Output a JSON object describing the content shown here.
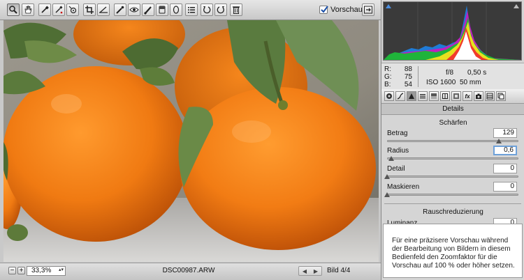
{
  "toolbar": {
    "tools": [
      {
        "name": "zoom-tool-button",
        "icon": "magnifier-icon",
        "active": true
      },
      {
        "name": "hand-tool-button",
        "icon": "hand-icon"
      },
      {
        "name": "white-balance-tool-button",
        "icon": "eyedropper-icon"
      },
      {
        "name": "color-sampler-tool-button",
        "icon": "color-sampler-icon"
      },
      {
        "name": "targeted-adjustment-tool-button",
        "icon": "target-adjust-icon"
      },
      {
        "name": "crop-tool-button",
        "icon": "crop-icon"
      },
      {
        "name": "straighten-tool-button",
        "icon": "straighten-icon"
      },
      {
        "name": "spot-removal-tool-button",
        "icon": "spot-removal-icon"
      },
      {
        "name": "red-eye-tool-button",
        "icon": "red-eye-icon"
      },
      {
        "name": "adjustment-brush-button",
        "icon": "brush-icon"
      },
      {
        "name": "graduated-filter-button",
        "icon": "graduated-filter-icon"
      },
      {
        "name": "radial-filter-button",
        "icon": "radial-filter-icon"
      },
      {
        "name": "preferences-button",
        "icon": "list-icon"
      },
      {
        "name": "rotate-left-button",
        "icon": "rotate-ccw-icon"
      },
      {
        "name": "rotate-right-button",
        "icon": "rotate-cw-icon"
      },
      {
        "name": "trash-button",
        "icon": "trash-icon"
      }
    ],
    "preview_label": "Vorschau",
    "preview_checked": true
  },
  "bottombar": {
    "zoom_minus": "−",
    "zoom_plus": "+",
    "zoom_value": "33,3%",
    "filename": "DSC00987.ARW",
    "image_count": "Bild 4/4"
  },
  "readout": {
    "r_label": "R:",
    "r_value": "88",
    "g_label": "G:",
    "g_value": "75",
    "b_label": "B:",
    "b_value": "54",
    "aperture": "f/8",
    "shutter": "0,50 s",
    "iso": "ISO 1600",
    "focal": "50 mm"
  },
  "panel": {
    "title": "Details",
    "sharpening_title": "Schärfen",
    "sharpening": [
      {
        "label": "Betrag",
        "value": "129",
        "level": 0.87
      },
      {
        "label": "Radius",
        "value": "0,6",
        "level": 0.03,
        "focused": true
      },
      {
        "label": "Detail",
        "value": "0",
        "level": 0.0
      },
      {
        "label": "Maskieren",
        "value": "0",
        "level": 0.0
      }
    ],
    "noise_title": "Rauschreduzierung",
    "noise_first_label": "Luminanz",
    "noise_first_value": "0",
    "hint": "Für eine präzisere Vorschau während der Bearbeitung von Bildern in diesem Bedienfeld den Zoomfaktor für die Vorschau auf 100 % oder höher setzen."
  },
  "colors": {
    "accent_focus": "#6ea1d9",
    "orange": "#ef7a12"
  }
}
